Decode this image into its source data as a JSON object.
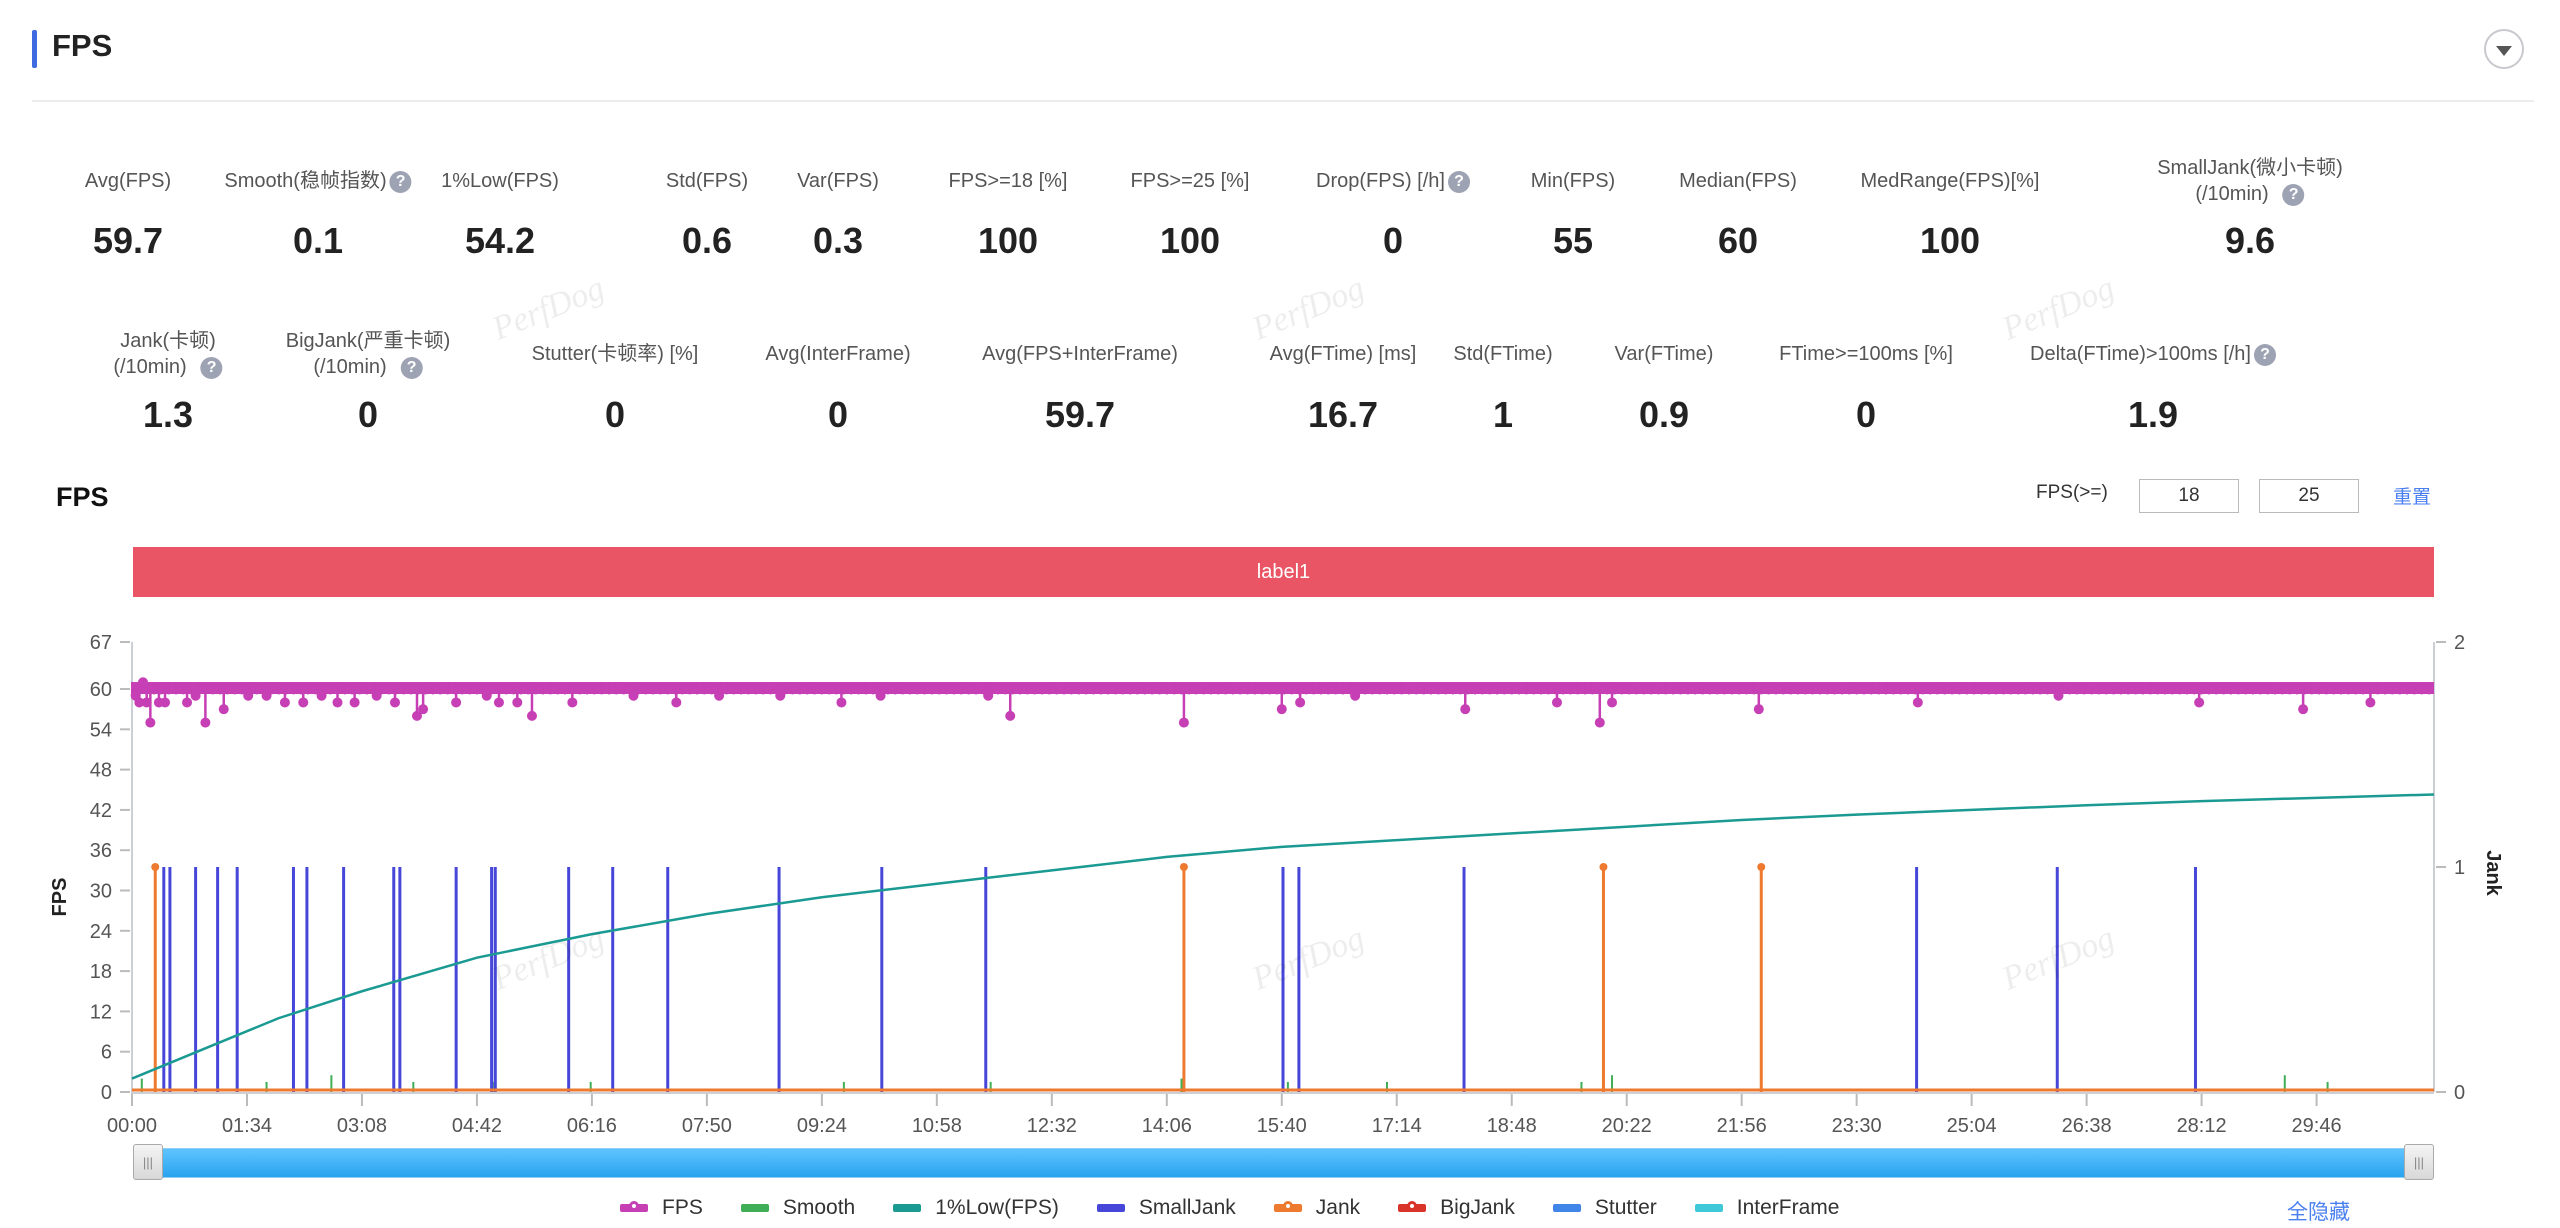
{
  "header": {
    "title": "FPS",
    "collapse_icon": "chevron-down-icon"
  },
  "metrics_row1": [
    {
      "label": "Avg(FPS)",
      "value": "59.7",
      "help": false
    },
    {
      "label": "Smooth(稳帧指数)",
      "value": "0.1",
      "help": true
    },
    {
      "label": "1%Low(FPS)",
      "value": "54.2",
      "help": false
    },
    {
      "label": "Std(FPS)",
      "value": "0.6",
      "help": false
    },
    {
      "label": "Var(FPS)",
      "value": "0.3",
      "help": false
    },
    {
      "label": "FPS>=18 [%]",
      "value": "100",
      "help": false
    },
    {
      "label": "FPS>=25 [%]",
      "value": "100",
      "help": false
    },
    {
      "label": "Drop(FPS) [/h]",
      "value": "0",
      "help": true
    },
    {
      "label": "Min(FPS)",
      "value": "55",
      "help": false
    },
    {
      "label": "Median(FPS)",
      "value": "60",
      "help": false
    },
    {
      "label": "MedRange(FPS)[%]",
      "value": "100",
      "help": false
    },
    {
      "label": "SmallJank(微小卡顿)",
      "label2": "(/10min)",
      "value": "9.6",
      "help": true
    }
  ],
  "metrics_row2": [
    {
      "label": "Jank(卡顿)",
      "label2": "(/10min)",
      "value": "1.3",
      "help": true
    },
    {
      "label": "BigJank(严重卡顿)",
      "label2": "(/10min)",
      "value": "0",
      "help": true
    },
    {
      "label": "Stutter(卡顿率) [%]",
      "value": "0",
      "help": false
    },
    {
      "label": "Avg(InterFrame)",
      "value": "0",
      "help": false
    },
    {
      "label": "Avg(FPS+InterFrame)",
      "value": "59.7",
      "help": false
    },
    {
      "label": "Avg(FTime) [ms]",
      "value": "16.7",
      "help": false
    },
    {
      "label": "Std(FTime)",
      "value": "1",
      "help": false
    },
    {
      "label": "Var(FTime)",
      "value": "0.9",
      "help": false
    },
    {
      "label": "FTime>=100ms [%]",
      "value": "0",
      "help": false
    },
    {
      "label": "Delta(FTime)>100ms [/h]",
      "value": "1.9",
      "help": true
    }
  ],
  "watermark": "PerfDog",
  "chart_controls": {
    "title": "FPS",
    "threshold_label": "FPS(>=)",
    "threshold_low": "18",
    "threshold_high": "25",
    "reset_label": "重置",
    "label_bar": "label1",
    "hide_all_label": "全隐藏"
  },
  "colors": {
    "fps": "#c63fb4",
    "smooth": "#3fae55",
    "low1": "#1a9a92",
    "smalljank": "#4646d8",
    "jank": "#ee7a30",
    "bigjank": "#d9342b",
    "stutter": "#3f86e8",
    "interframe": "#3fc8d8",
    "label_bar": "#e95564",
    "accent": "#3f6ae0",
    "link": "#4a7ff0"
  },
  "chart_data": {
    "type": "line",
    "title": "FPS",
    "xlabel": "",
    "ylabel": "FPS",
    "ylabel_right": "Jank",
    "ylim": [
      0,
      67
    ],
    "ylim_right": [
      0,
      2
    ],
    "yticks": [
      0,
      6,
      12,
      18,
      24,
      30,
      36,
      42,
      48,
      54,
      60,
      67
    ],
    "yticks_right": [
      0,
      1,
      2
    ],
    "x_range_seconds": [
      0,
      1882
    ],
    "xtick_labels": [
      "00:00",
      "01:34",
      "03:08",
      "04:42",
      "06:16",
      "07:50",
      "09:24",
      "10:58",
      "12:32",
      "14:06",
      "15:40",
      "17:14",
      "18:48",
      "20:22",
      "21:56",
      "23:30",
      "25:04",
      "26:38",
      "28:12",
      "29:46"
    ],
    "xtick_seconds": [
      0,
      94,
      188,
      282,
      376,
      470,
      564,
      658,
      752,
      846,
      940,
      1034,
      1128,
      1222,
      1316,
      1410,
      1504,
      1598,
      1692,
      1786
    ],
    "legend": [
      "FPS",
      "Smooth",
      "1%Low(FPS)",
      "SmallJank",
      "Jank",
      "BigJank",
      "Stutter",
      "InterFrame"
    ],
    "legend_placement": "bottom",
    "series": [
      {
        "name": "FPS",
        "baseline": 60,
        "dips": [
          [
            3,
            59
          ],
          [
            6,
            58
          ],
          [
            9,
            61
          ],
          [
            12,
            58
          ],
          [
            15,
            55
          ],
          [
            22,
            58
          ],
          [
            27,
            58
          ],
          [
            45,
            58
          ],
          [
            52,
            59
          ],
          [
            60,
            55
          ],
          [
            75,
            57
          ],
          [
            95,
            59
          ],
          [
            110,
            59
          ],
          [
            125,
            58
          ],
          [
            140,
            58
          ],
          [
            155,
            59
          ],
          [
            168,
            58
          ],
          [
            182,
            58
          ],
          [
            200,
            59
          ],
          [
            215,
            58
          ],
          [
            233,
            56
          ],
          [
            238,
            57
          ],
          [
            265,
            58
          ],
          [
            290,
            59
          ],
          [
            300,
            58
          ],
          [
            315,
            58
          ],
          [
            327,
            56
          ],
          [
            360,
            58
          ],
          [
            410,
            59
          ],
          [
            445,
            58
          ],
          [
            480,
            59
          ],
          [
            530,
            59
          ],
          [
            580,
            58
          ],
          [
            612,
            59
          ],
          [
            700,
            59
          ],
          [
            718,
            56
          ],
          [
            860,
            55
          ],
          [
            940,
            57
          ],
          [
            955,
            58
          ],
          [
            1000,
            59
          ],
          [
            1090,
            57
          ],
          [
            1165,
            58
          ],
          [
            1200,
            55
          ],
          [
            1210,
            58
          ],
          [
            1330,
            57
          ],
          [
            1460,
            58
          ],
          [
            1575,
            59
          ],
          [
            1690,
            58
          ],
          [
            1775,
            57
          ],
          [
            1830,
            58
          ]
        ]
      },
      {
        "name": "1%Low(FPS)",
        "points": [
          [
            0,
            2
          ],
          [
            60,
            6.5
          ],
          [
            120,
            11
          ],
          [
            188,
            15
          ],
          [
            282,
            20
          ],
          [
            376,
            23.5
          ],
          [
            470,
            26.5
          ],
          [
            564,
            29
          ],
          [
            658,
            31
          ],
          [
            752,
            33
          ],
          [
            846,
            35
          ],
          [
            940,
            36.5
          ],
          [
            1034,
            37.5
          ],
          [
            1128,
            38.5
          ],
          [
            1222,
            39.5
          ],
          [
            1316,
            40.5
          ],
          [
            1410,
            41.3
          ],
          [
            1504,
            42
          ],
          [
            1598,
            42.7
          ],
          [
            1692,
            43.3
          ],
          [
            1786,
            43.8
          ],
          [
            1882,
            44.3
          ]
        ]
      },
      {
        "name": "SmallJank",
        "axis": "right",
        "value": 1,
        "times": [
          26,
          31,
          52,
          70,
          86,
          132,
          143,
          173,
          214,
          219,
          265,
          294,
          297,
          357,
          393,
          438,
          529,
          613,
          698,
          941,
          954,
          1089,
          1459,
          1574,
          1687
        ]
      },
      {
        "name": "Jank",
        "axis": "right",
        "value": 1,
        "times": [
          19,
          860,
          1203,
          1332
        ]
      },
      {
        "name": "BigJank",
        "axis": "right",
        "value": 0,
        "times": []
      },
      {
        "name": "Smooth",
        "axis": "left",
        "points": [
          [
            8,
            2
          ],
          [
            110,
            1.5
          ],
          [
            163,
            2.5
          ],
          [
            230,
            1.5
          ],
          [
            295,
            1.5
          ],
          [
            375,
            1.5
          ],
          [
            582,
            1.5
          ],
          [
            702,
            1.5
          ],
          [
            858,
            2
          ],
          [
            945,
            1.5
          ],
          [
            1026,
            1.5
          ],
          [
            1185,
            1.5
          ],
          [
            1210,
            2.5
          ],
          [
            1760,
            2.5
          ],
          [
            1795,
            1.5
          ]
        ]
      },
      {
        "name": "Stutter",
        "axis": "left",
        "values": "0"
      },
      {
        "name": "InterFrame",
        "axis": "left",
        "values": "0"
      }
    ]
  }
}
